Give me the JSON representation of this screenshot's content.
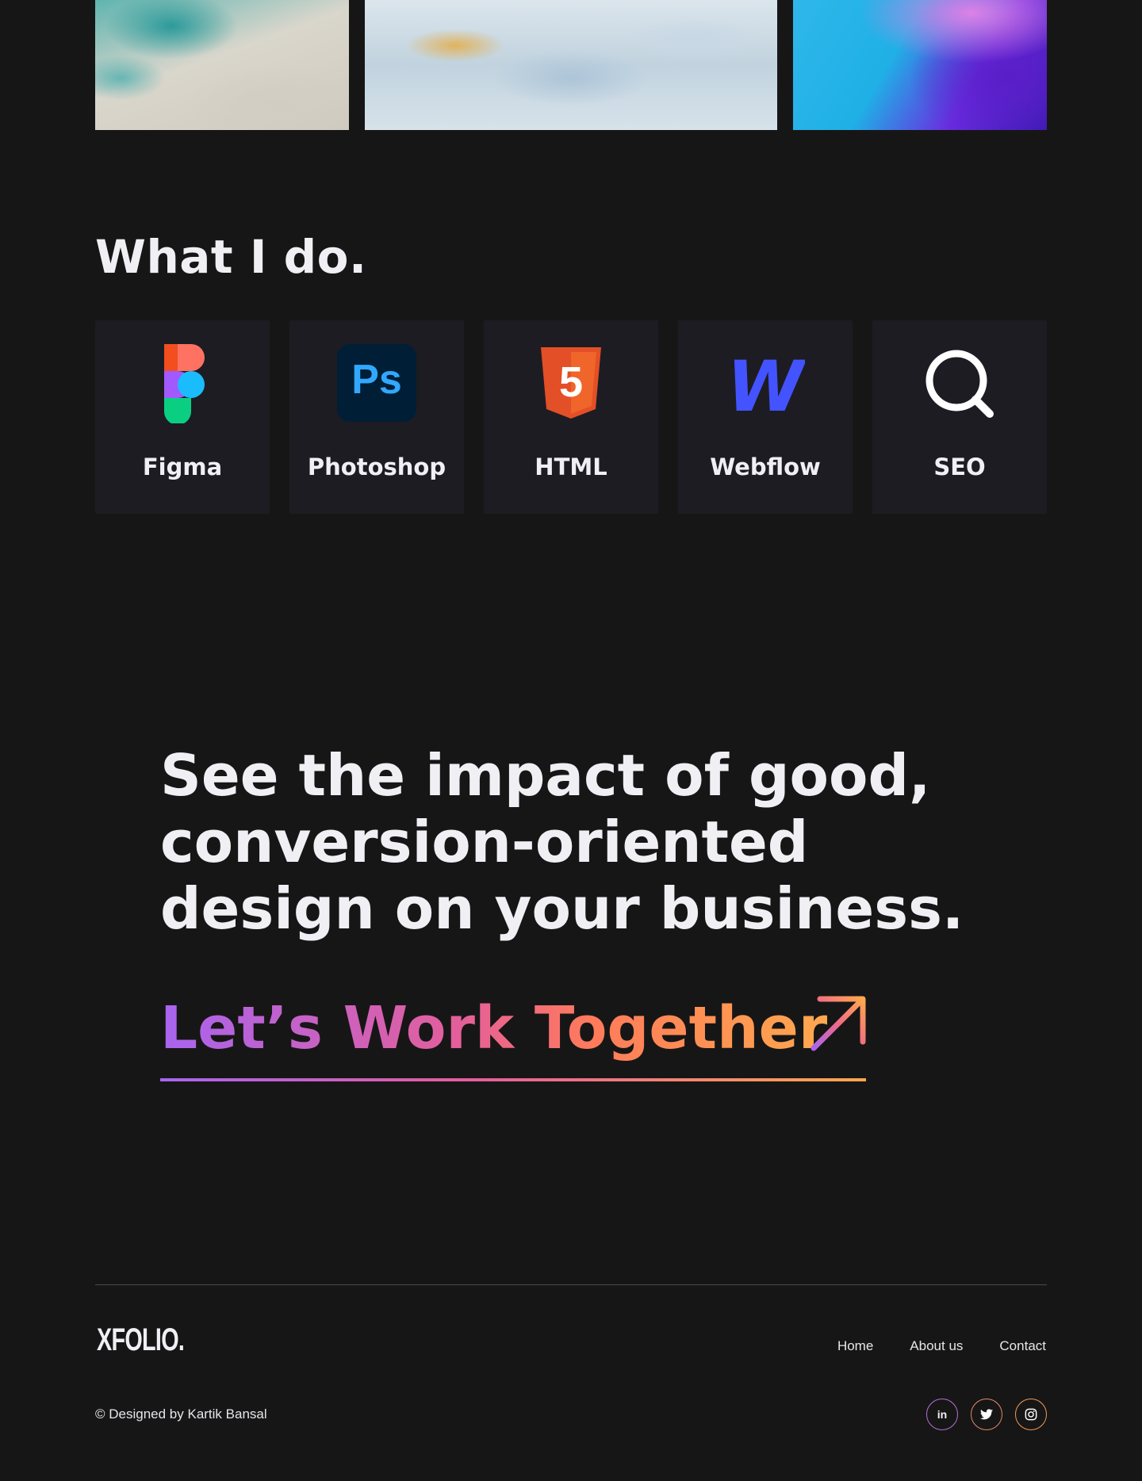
{
  "gallery": {
    "tiles": [
      "teal-marble-image",
      "blue-marble-image",
      "purple-gradient-image"
    ]
  },
  "skills_section": {
    "title": "What I do.",
    "items": [
      {
        "label": "Figma",
        "icon": "figma-icon"
      },
      {
        "label": "Photoshop",
        "icon": "photoshop-icon",
        "icon_text": "Ps"
      },
      {
        "label": "HTML",
        "icon": "html5-icon",
        "icon_text": "5"
      },
      {
        "label": "Webflow",
        "icon": "webflow-icon",
        "icon_text": "W"
      },
      {
        "label": "SEO",
        "icon": "search-icon"
      }
    ]
  },
  "cta": {
    "heading": "See the impact of good, conversion-oriented design on your business.",
    "link_text": "Let’s Work Together",
    "gradient_colors": [
      "#a864f0",
      "#e45f9a",
      "#ffa84e"
    ]
  },
  "footer": {
    "logo": "XFOLIO.",
    "nav": [
      "Home",
      "About us",
      "Contact"
    ],
    "copyright": "© Designed by Kartik Bansal",
    "socials": [
      {
        "name": "linkedin-icon",
        "text": "in"
      },
      {
        "name": "twitter-icon"
      },
      {
        "name": "instagram-icon"
      }
    ]
  },
  "colors": {
    "background": "#171616",
    "card": "#1d1c23",
    "text": "#f0eff4"
  }
}
